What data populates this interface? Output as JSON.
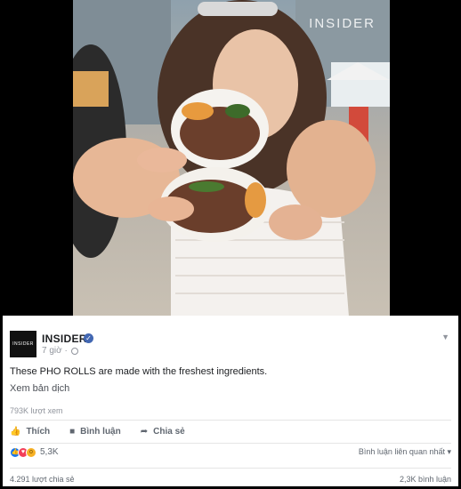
{
  "video": {
    "watermark": "INSIDER"
  },
  "post": {
    "page_name": "INSIDER",
    "avatar_text": "INSIDER",
    "time": "7 giờ ·",
    "text": "These PHO ROLLS are made with the freshest ingredients.",
    "translate_link": "Xem bản dịch",
    "views": "793K lượt xem"
  },
  "actions": {
    "like": "Thích",
    "comment": "Bình luận",
    "share": "Chia sẻ"
  },
  "reactions": {
    "count": "5,3K",
    "sort_label": "Bình luận liên quan nhất ▾"
  },
  "footer": {
    "shares": "4.291 lượt chia sẻ",
    "comments": "2,3K bình luận"
  }
}
